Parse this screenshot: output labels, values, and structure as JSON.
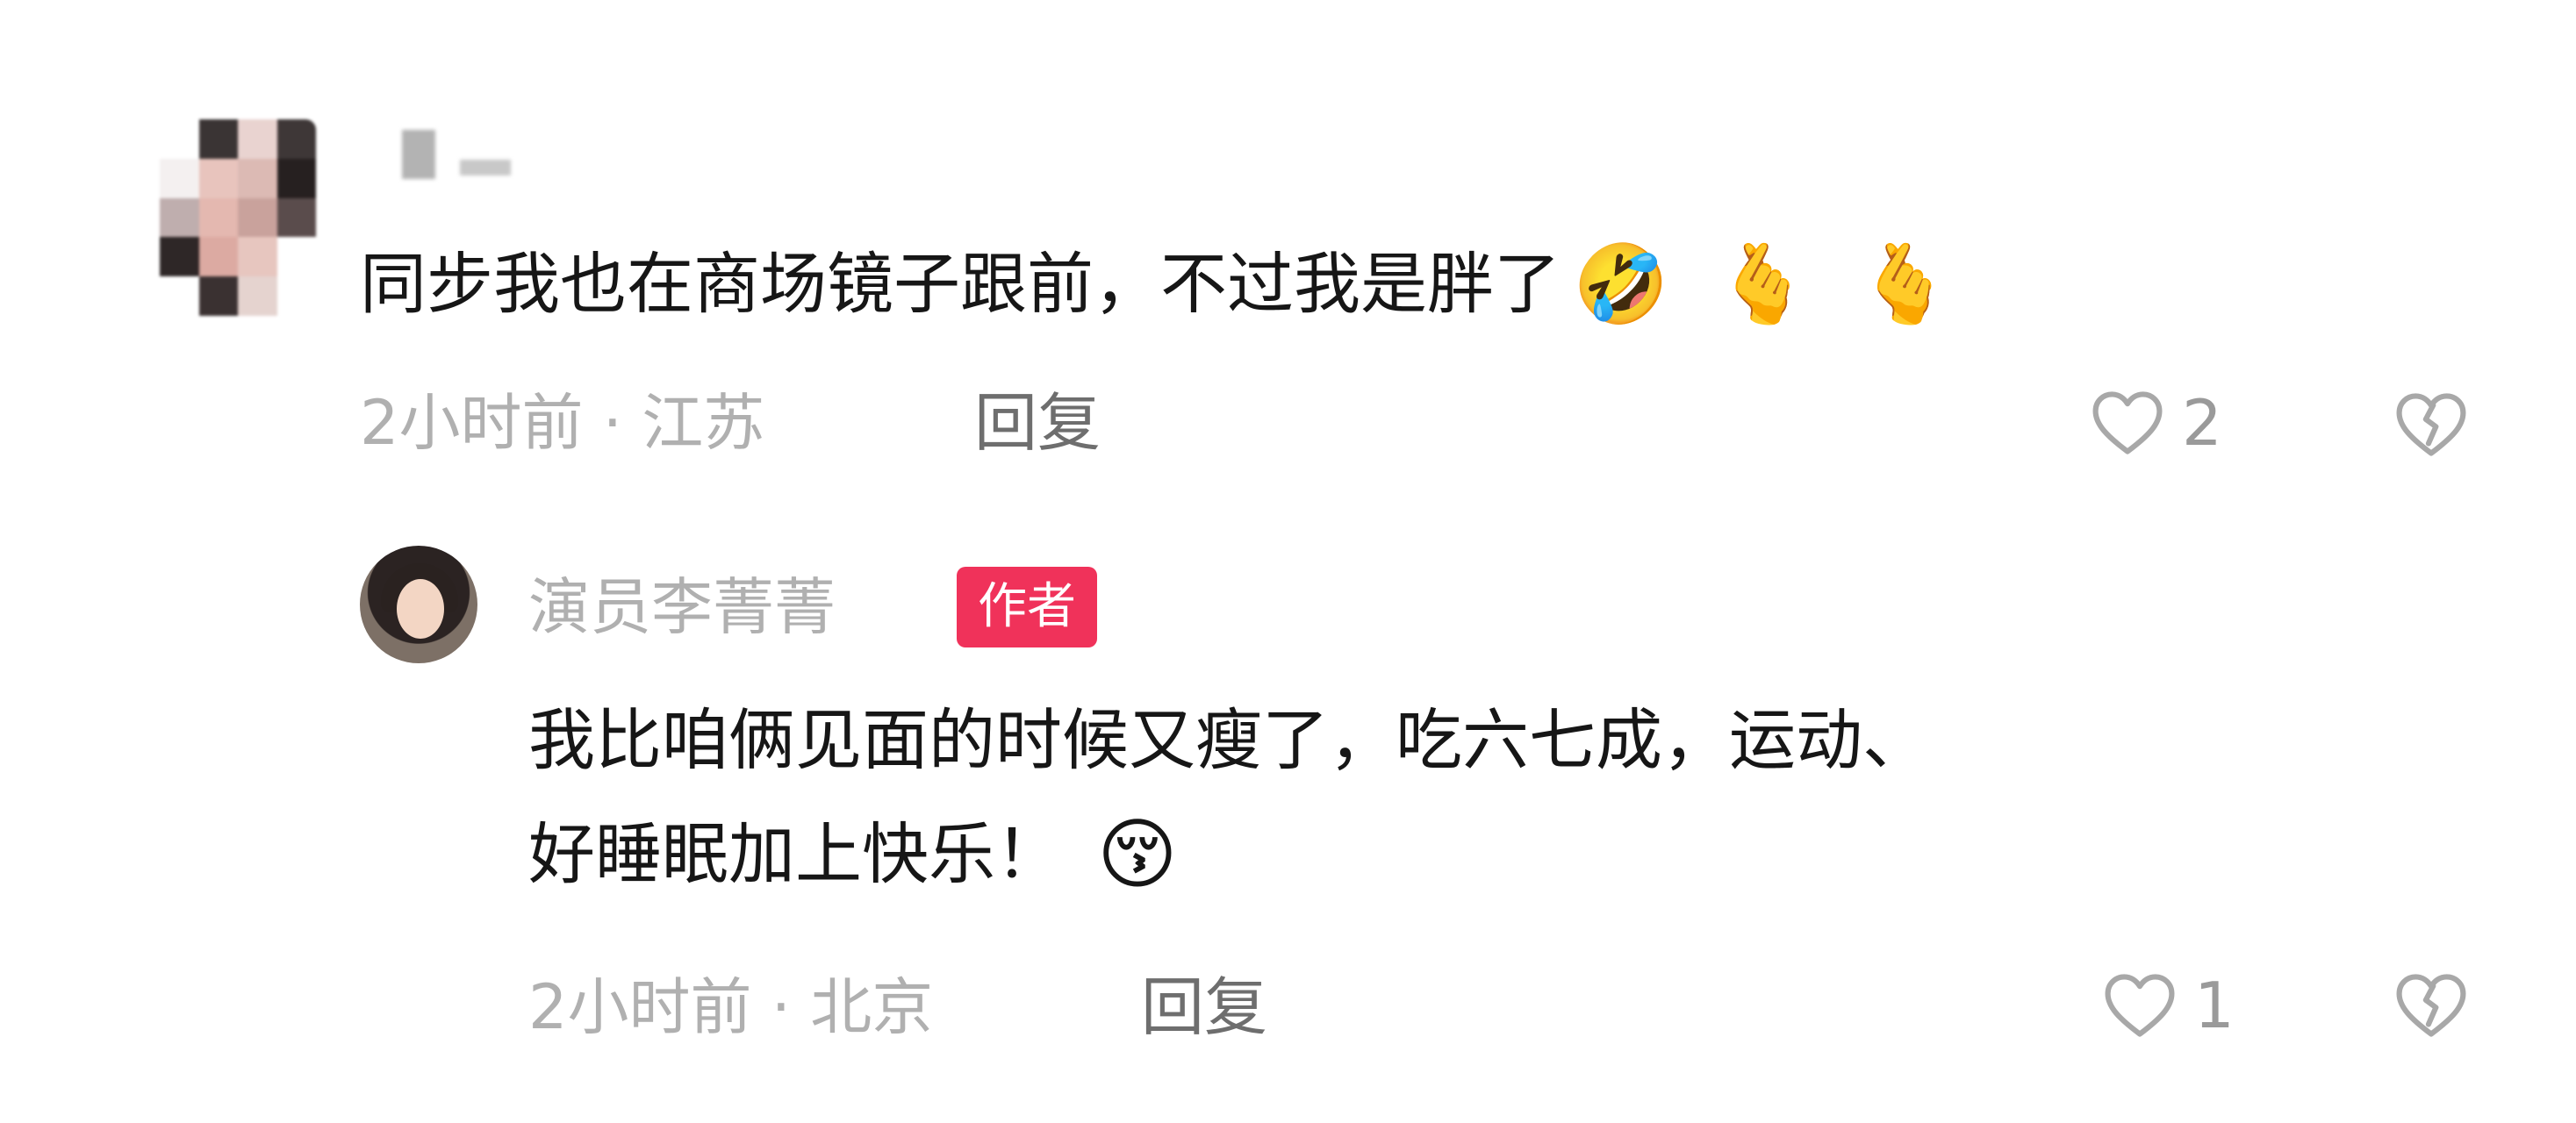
{
  "comments": [
    {
      "avatar": "pixelated-avatar",
      "username": "",
      "text": "同步我也在商场镜子跟前，不过我是胖了",
      "emojis": [
        "🤣",
        "🫰",
        "🫰"
      ],
      "meta": "2小时前 · 江苏",
      "reply_label": "回复",
      "like_count": "2",
      "like_icon": "heart-outline-icon",
      "dislike_icon": "broken-heart-icon"
    },
    {
      "avatar": "author-photo-avatar",
      "username": "演员李菁菁",
      "badge": "作者",
      "text_line1": "我比咱俩见面的时候又瘦了，吃六七成，运动、",
      "text_line2": "好睡眠加上快乐！",
      "emojis": [
        "😚"
      ],
      "meta": "2小时前 · 北京",
      "reply_label": "回复",
      "like_count": "1",
      "like_icon": "heart-outline-icon",
      "dislike_icon": "broken-heart-icon"
    }
  ],
  "colors": {
    "badge": "#f0325a",
    "meta_text": "#b0b0b0",
    "reply_text": "#6e6e6e",
    "body_text": "#161616"
  }
}
